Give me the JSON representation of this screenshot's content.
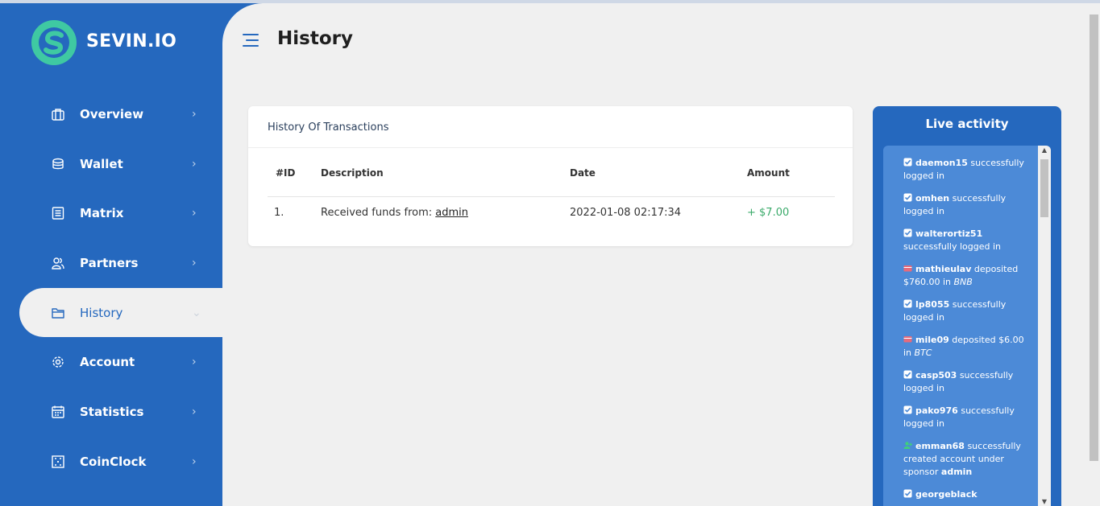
{
  "brand": {
    "name": "SEVIN.IO",
    "logo_color": "#3fc9a2"
  },
  "colors": {
    "primary": "#2568be",
    "background": "#f0f0f0",
    "amount_positive": "#3aaa6a"
  },
  "sidebar": {
    "items": [
      {
        "label": "Overview",
        "icon": "briefcase-icon",
        "active": false
      },
      {
        "label": "Wallet",
        "icon": "coins-icon",
        "active": false
      },
      {
        "label": "Matrix",
        "icon": "list-icon",
        "active": false
      },
      {
        "label": "Partners",
        "icon": "users-icon",
        "active": false
      },
      {
        "label": "History",
        "icon": "folder-icon",
        "active": true
      },
      {
        "label": "Account",
        "icon": "gear-icon",
        "active": false
      },
      {
        "label": "Statistics",
        "icon": "calendar-icon",
        "active": false
      },
      {
        "label": "CoinClock",
        "icon": "grid-icon",
        "active": false
      }
    ]
  },
  "header": {
    "title": "History"
  },
  "transactions": {
    "title": "History Of Transactions",
    "columns": [
      "#ID",
      "Description",
      "Date",
      "Amount"
    ],
    "rows": [
      {
        "id": "1.",
        "description_prefix": "Received funds from:",
        "description_link": "admin",
        "date": "2022-01-08 02:17:34",
        "amount": "+ $7.00"
      }
    ]
  },
  "live_activity": {
    "title": "Live activity",
    "items": [
      {
        "icon": "check-icon",
        "user": "daemon15",
        "text": " successfully logged in"
      },
      {
        "icon": "check-icon",
        "user": "omhen",
        "text": " successfully logged in"
      },
      {
        "icon": "check-icon",
        "user": "walterortiz51",
        "text": " successfully logged in"
      },
      {
        "icon": "deposit-icon",
        "user": "mathieulav",
        "text": " deposited $760.00 in ",
        "currency": "BNB"
      },
      {
        "icon": "check-icon",
        "user": "lp8055",
        "text": " successfully logged in"
      },
      {
        "icon": "deposit-icon",
        "user": "mile09",
        "text": " deposited $6.00 in ",
        "currency": "BTC"
      },
      {
        "icon": "check-icon",
        "user": "casp503",
        "text": " successfully logged in"
      },
      {
        "icon": "check-icon",
        "user": "pako976",
        "text": " successfully logged in"
      },
      {
        "icon": "user-add-icon",
        "user": "emman68",
        "text": " successfully created account under sponsor ",
        "sponsor": "admin"
      },
      {
        "icon": "check-icon",
        "user": "georgeblack",
        "text": ""
      }
    ]
  }
}
